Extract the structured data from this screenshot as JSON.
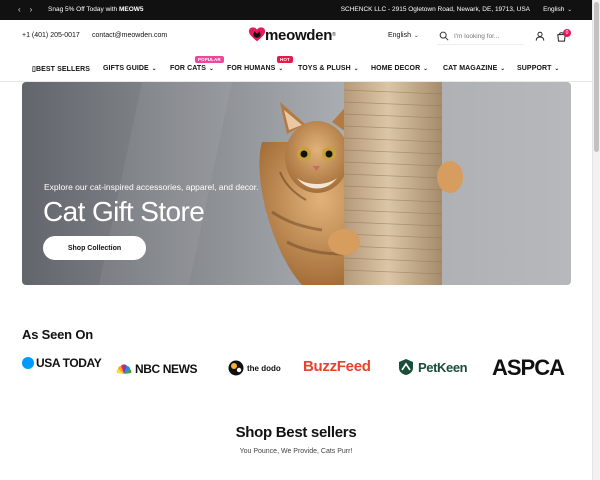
{
  "announcement": {
    "promo_text": "Snag 5% Off Today with ",
    "promo_code": "MEOW5",
    "address": "SCHENCK LLC - 2915 Ogletown Road, Newark, DE, 19713, USA",
    "language": "English"
  },
  "header": {
    "phone": "+1 (401) 205-0017",
    "email": "contact@meowden.com",
    "logo_text": "meowden",
    "logo_reg": "®",
    "language": "English",
    "search_placeholder": "I'm looking for...",
    "cart_count": "0"
  },
  "nav": {
    "items": [
      {
        "label": "BEST SELLERS",
        "icon": "square-outline-icon"
      },
      {
        "label": "GIFTS GUIDE"
      },
      {
        "label": "FOR CATS",
        "badge": "POPULAR"
      },
      {
        "label": "FOR HUMANS",
        "badge": "HOT"
      },
      {
        "label": "TOYS & PLUSH"
      },
      {
        "label": "HOME DECOR"
      },
      {
        "label": "CAT MAGAZINE"
      },
      {
        "label": "SUPPORT"
      }
    ]
  },
  "hero": {
    "subtitle": "Explore our cat-inspired accessories, apparel, and decor.",
    "title": "Cat Gift Store",
    "cta": "Shop Collection"
  },
  "as_seen_on": {
    "title": "As Seen On",
    "logos": [
      "USA TODAY",
      "NBC NEWS",
      "the dodo",
      "BuzzFeed",
      "PetKeen",
      "ASPCA"
    ]
  },
  "best_sellers": {
    "title": "Shop Best sellers",
    "subtitle": "You Pounce, We Provide, Cats Purr!"
  },
  "colors": {
    "topbar_bg": "#111111",
    "accent_pink": "#e8195a",
    "badge_popular": "#ec4899",
    "badge_hot": "#e11d48",
    "usa_today_blue": "#009bff",
    "buzzfeed_red": "#e8412c",
    "petkeen_green": "#1a4d3a"
  }
}
